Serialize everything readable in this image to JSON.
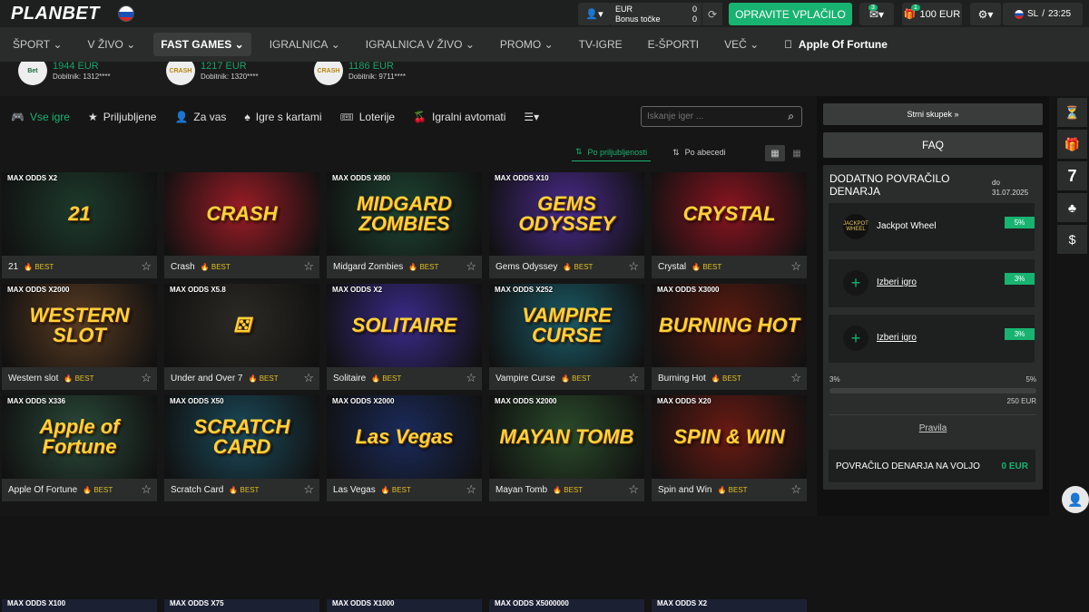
{
  "header": {
    "logo": "PLANBET",
    "balance": {
      "eur_label": "EUR",
      "eur_value": "0",
      "bonus_label": "Bonus točke",
      "bonus_value": "0"
    },
    "deposit_label": "OPRAVITE VPLAČILO",
    "messages_badge": "3",
    "bonus_badge": "1",
    "bonus_amount": "100 EUR",
    "lang": "SL",
    "time": "23:25"
  },
  "nav": [
    "ŠPORT",
    "V ŽIVO",
    "FAST GAMES",
    "IGRALNICA",
    "IGRALNICA V ŽIVO",
    "PROMO",
    "TV-IGRE",
    "E-ŠPORTI",
    "VEČ",
    "Apple Of Fortune"
  ],
  "winners": [
    {
      "logo": "Bet",
      "amount": "1944 EUR",
      "user": "Dobitnik: 1312****"
    },
    {
      "logo": "CRASH",
      "amount": "1217 EUR",
      "user": "Dobitnik: 1320****"
    },
    {
      "logo": "CRASH",
      "amount": "1186 EUR",
      "user": "Dobitnik: 9711****"
    }
  ],
  "tabs": [
    "Vse igre",
    "Priljubljene",
    "Za vas",
    "Igre s kartami",
    "Loterije",
    "Igralni avtomati"
  ],
  "search": {
    "placeholder": "Iskanje iger ..."
  },
  "sort": {
    "popular": "Po priljubljenosti",
    "alpha": "Po abecedi"
  },
  "best_label": "BEST",
  "games": [
    {
      "name": "21",
      "odds": "MAX ODDS X2",
      "art": "21",
      "bg": "#1d3a2c"
    },
    {
      "name": "Crash",
      "odds": "",
      "art": "CRASH",
      "bg": "#9b1c26"
    },
    {
      "name": "Midgard Zombies",
      "odds": "MAX ODDS X800",
      "art": "MIDGARD ZOMBIES",
      "bg": "#1d4432"
    },
    {
      "name": "Gems Odyssey",
      "odds": "MAX ODDS X10",
      "art": "GEMS ODYSSEY",
      "bg": "#4a2a8c"
    },
    {
      "name": "Crystal",
      "odds": "",
      "art": "CRYSTAL",
      "bg": "#8a1420"
    },
    {
      "name": "Western slot",
      "odds": "MAX ODDS X2000",
      "art": "WESTERN SLOT",
      "bg": "#5a3b22"
    },
    {
      "name": "Under and Over 7",
      "odds": "MAX ODDS X5.8",
      "art": "⚄",
      "bg": "#2c2a24"
    },
    {
      "name": "Solitaire",
      "odds": "MAX ODDS X2",
      "art": "SOLITAIRE",
      "bg": "#3a2a8a"
    },
    {
      "name": "Vampire Curse",
      "odds": "MAX ODDS X252",
      "art": "VAMPIRE CURSE",
      "bg": "#1a5a66"
    },
    {
      "name": "Burning Hot",
      "odds": "MAX ODDS X3000",
      "art": "BURNING HOT",
      "bg": "#5a1a10"
    },
    {
      "name": "Apple Of Fortune",
      "odds": "MAX ODDS X336",
      "art": "Apple of Fortune",
      "bg": "#2a4a3a"
    },
    {
      "name": "Scratch Card",
      "odds": "MAX ODDS X50",
      "art": "SCRATCH CARD",
      "bg": "#1a4a5a"
    },
    {
      "name": "Las Vegas",
      "odds": "MAX ODDS X2000",
      "art": "Las Vegas",
      "bg": "#1a2a5a"
    },
    {
      "name": "Mayan Tomb",
      "odds": "MAX ODDS X2000",
      "art": "MAYAN TOMB",
      "bg": "#2a4a2a"
    },
    {
      "name": "Spin and Win",
      "odds": "MAX ODDS X20",
      "art": "SPIN & WIN",
      "bg": "#6a1a12"
    }
  ],
  "partial_odds": [
    "MAX ODDS X100",
    "MAX ODDS X75",
    "MAX ODDS X1000",
    "MAX ODDS X5000000",
    "MAX ODDS X2"
  ],
  "sidebar": {
    "strni": "Strni skupek",
    "faq": "FAQ",
    "cashback_title": "DODATNO POVRAČILO DENARJA",
    "date_label": "do",
    "date": "31.07.2025",
    "items": [
      {
        "name": "Jackpot Wheel",
        "pct": "5%",
        "icon": "JACKPOT WHEEL"
      },
      {
        "name": "Izberi igro",
        "pct": "3%",
        "icon": "+"
      },
      {
        "name": "Izberi igro",
        "pct": "3%",
        "icon": "+"
      }
    ],
    "range_min": "3%",
    "range_max": "5%",
    "range_amount": "250 EUR",
    "range_progress": 0,
    "rules": "Pravila",
    "voljo_label": "POVRAČILO DENARJA NA VOLJO",
    "voljo_value": "0 EUR"
  },
  "rail": [
    "⏳",
    "🎁",
    "7",
    "♣",
    "$"
  ]
}
